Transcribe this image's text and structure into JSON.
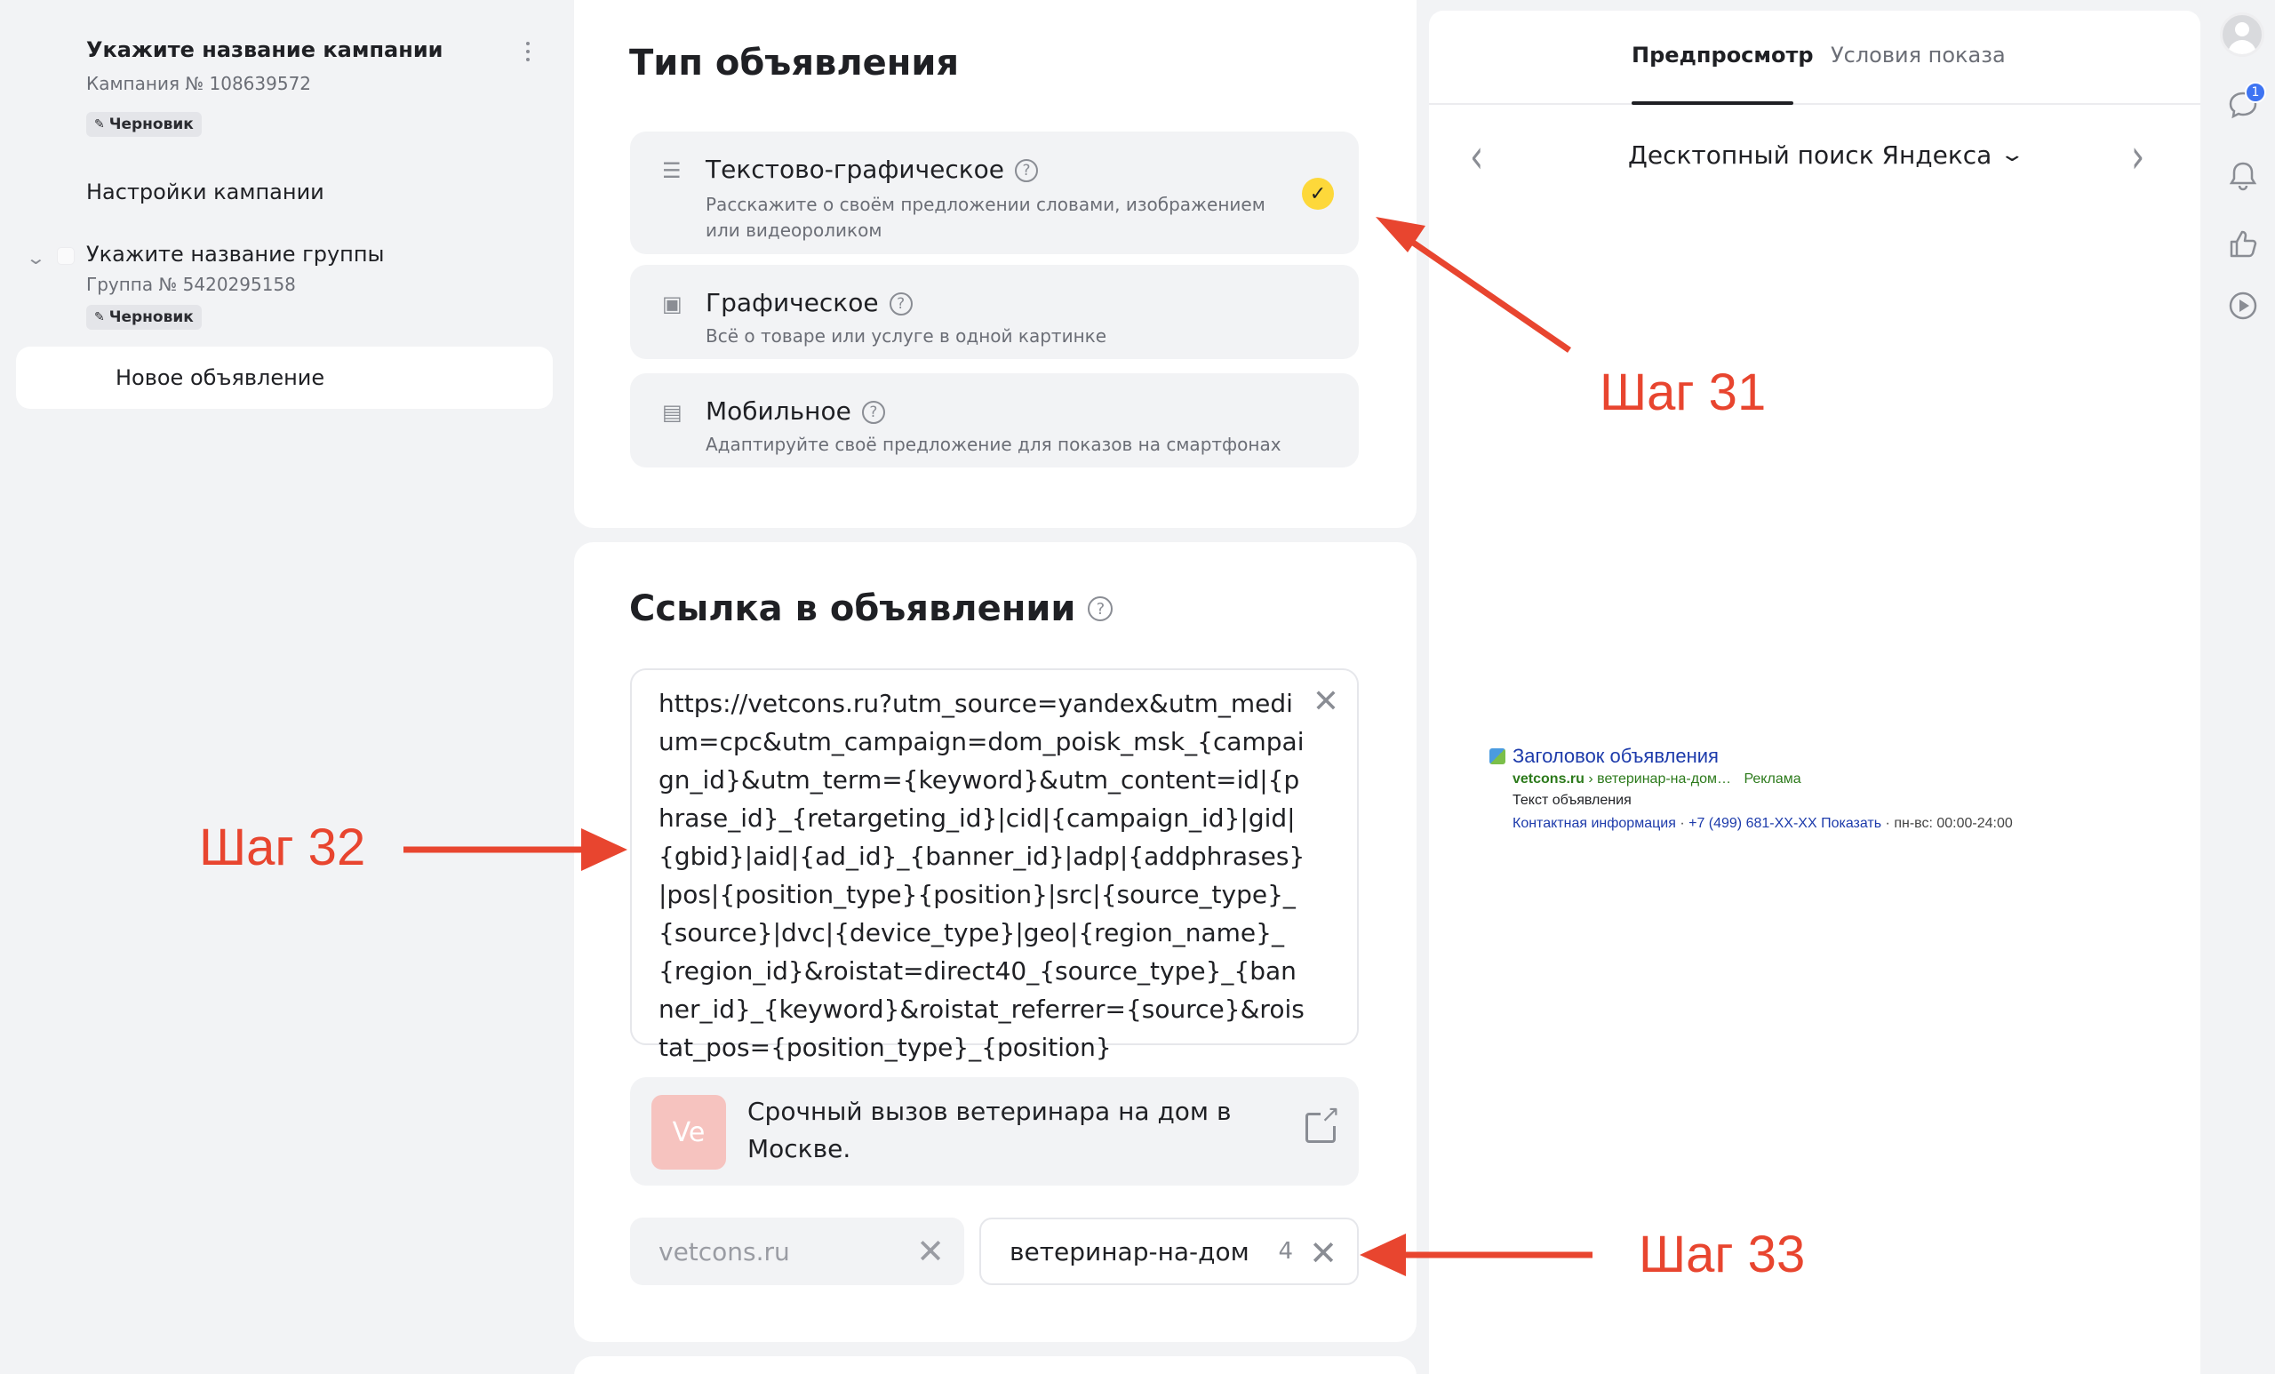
{
  "sidebar": {
    "campaign_title": "Укажите название кампании",
    "campaign_number": "Кампания № 108639572",
    "draft_label": "Черновик",
    "settings_label": "Настройки кампании",
    "group_title": "Укажите название группы",
    "group_number": "Группа № 5420295158",
    "group_draft_label": "Черновик",
    "new_ad_label": "Новое объявление"
  },
  "ad_type": {
    "heading": "Тип объявления",
    "options": [
      {
        "title": "Текстово-графическое",
        "desc": "Расскажите о своём предложении словами, изображением или видеороликом",
        "icon": "text-lines-icon",
        "selected": true
      },
      {
        "title": "Графическое",
        "desc": "Всё о товаре или услуге в одной картинке",
        "icon": "image-icon",
        "selected": false
      },
      {
        "title": "Мобильное",
        "desc": "Адаптируйте своё предложение для показов на смартфонах",
        "icon": "mobile-icon",
        "selected": false
      }
    ]
  },
  "link": {
    "heading": "Ссылка в объявлении",
    "url": "https://vetcons.ru?utm_source=yandex&utm_medium=cpc&utm_campaign=dom_poisk_msk_{campaign_id}&utm_term={keyword}&utm_content=id|{phrase_id}_{retargeting_id}|cid|{campaign_id}|gid|{gbid}|aid|{ad_id}_{banner_id}|adp|{addphrases}|pos|{position_type}{position}|src|{source_type}_{source}|dvc|{device_type}|geo|{region_name}_{region_id}&roistat=direct40_{source_type}_{banner_id}_{keyword}&roistat_referrer={source}&roistat_pos={position_type}_{position}",
    "site_favicon_text": "Ve",
    "site_title": "Срочный вызов ветеринара на дом в Москве.",
    "domain": "vetcons.ru",
    "display_path": "ветеринар-на-дом",
    "display_path_remaining": "4"
  },
  "preview": {
    "tabs": [
      "Предпросмотр",
      "Условия показа"
    ],
    "device": "Десктопный поиск Яндекса",
    "serp": {
      "title": "Заголовок объявления",
      "domain": "vetcons.ru",
      "path": "› ветеринар-на-дом…",
      "ad_label": "Реклама",
      "text": "Текст объявления",
      "contact": "Контактная информация",
      "phone": "+7 (499) 681-XX-XX Показать",
      "hours": "пн-вс: 00:00-24:00"
    }
  },
  "iconbar": {
    "notification_count": "1"
  },
  "annotations": {
    "step31": "Шаг 31",
    "step32": "Шаг 32",
    "step33": "Шаг 33",
    "color": "#e8452f"
  },
  "colors": {
    "accent_check": "#fdd83a",
    "link_blue": "#1d3bab",
    "serp_green": "#2c7a1b",
    "notification_blue": "#3e74f2"
  }
}
